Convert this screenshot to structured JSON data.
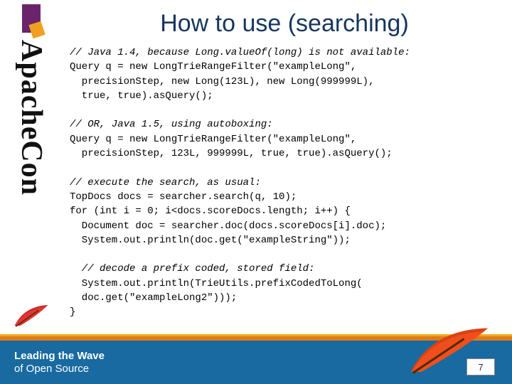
{
  "brand": {
    "vertical_text": "ApacheCon",
    "footer_line1": "Leading the Wave",
    "footer_line2": "of Open Source"
  },
  "title": "How to use (searching)",
  "code": {
    "c1": "// Java 1.4, because Long.valueOf(long) is not available:",
    "l1": "Query q = new LongTrieRangeFilter(\"exampleLong\",",
    "l2": "  precisionStep, new Long(123L), new Long(999999L),",
    "l3": "  true, true).asQuery();",
    "c2": "// OR, Java 1.5, using autoboxing:",
    "l4": "Query q = new LongTrieRangeFilter(\"exampleLong\",",
    "l5": "  precisionStep, 123L, 999999L, true, true).asQuery();",
    "c3": "// execute the search, as usual:",
    "l6": "TopDocs docs = searcher.search(q, 10);",
    "l7": "for (int i = 0; i<docs.scoreDocs.length; i++) {",
    "l8": "  Document doc = searcher.doc(docs.scoreDocs[i].doc);",
    "l9": "  System.out.println(doc.get(\"exampleString\"));",
    "c4": "  // decode a prefix coded, stored field:",
    "l10": "  System.out.println(TrieUtils.prefixCodedToLong(",
    "l11": "  doc.get(\"exampleLong2\")));",
    "l12": "}"
  },
  "page_number": "7"
}
